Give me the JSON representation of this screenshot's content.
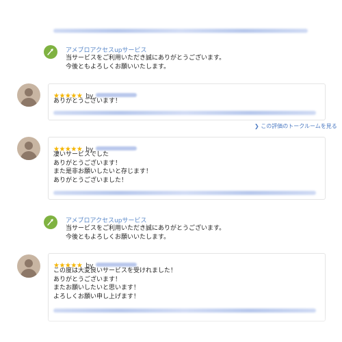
{
  "reply_header": "アメブロアクセスupサービス",
  "reply_body": "当サービスをご利用いただき誠にありがとうございます。\n今後ともよろしくお願いいたします。",
  "by_label": "by",
  "stars": "★★★★★",
  "thread_link": "この評価のトークルームを見る",
  "link_prefix": "❯",
  "reviews": [
    {
      "text": "ありがとうございます！"
    },
    {
      "text": "凄いサービスでした\nありがとうございます！\nまた是非お願いしたいと存じます！\nありがとうございました！"
    },
    {
      "text": "この度は大変良いサービスを受けれました！\nありがとうございます！\nまたお願いしたいと思います！\nよろしくお願い申し上げます！"
    }
  ],
  "colors": {
    "accent_green": "#7fb241",
    "star": "#f4b400",
    "link": "#4a78c2"
  }
}
